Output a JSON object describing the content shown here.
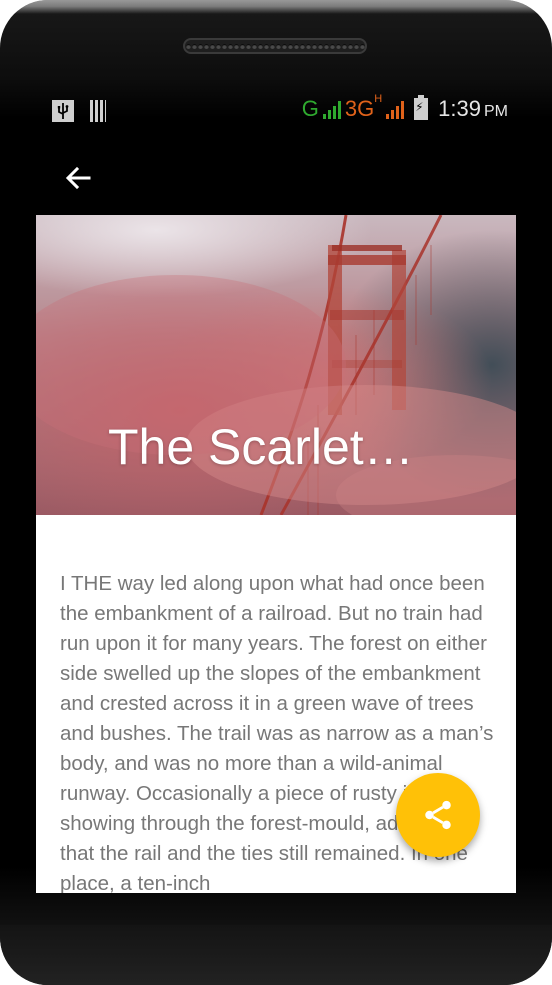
{
  "status_bar": {
    "network_g": "G",
    "network_3g": "3G",
    "network_3g_sup": "H",
    "time": "1:39",
    "ampm": "PM",
    "icons": [
      "usb-icon",
      "storage-icon",
      "signal-icon",
      "battery-charging-icon"
    ],
    "colors": {
      "g_color": "#2faa2f",
      "3g_color": "#e0621a"
    }
  },
  "app_bar": {
    "back_icon": "arrow-left-icon"
  },
  "article": {
    "title": "The Scarlet…",
    "body": "I THE way led along upon what had once been the embankment of a railroad. But no train had run upon it for many years. The forest on either side swelled up the slopes of the embankment and crested across it in a green wave of trees and bushes. The trail was as narrow as a man’s body, and was no more than a wild-animal runway. Occasionally a piece of rusty iron, showing through the forest-mould, advertised that the rail and the ties still remained. In one place, a ten-inch"
  },
  "fab": {
    "icon": "share-icon",
    "color": "#ffc107"
  }
}
